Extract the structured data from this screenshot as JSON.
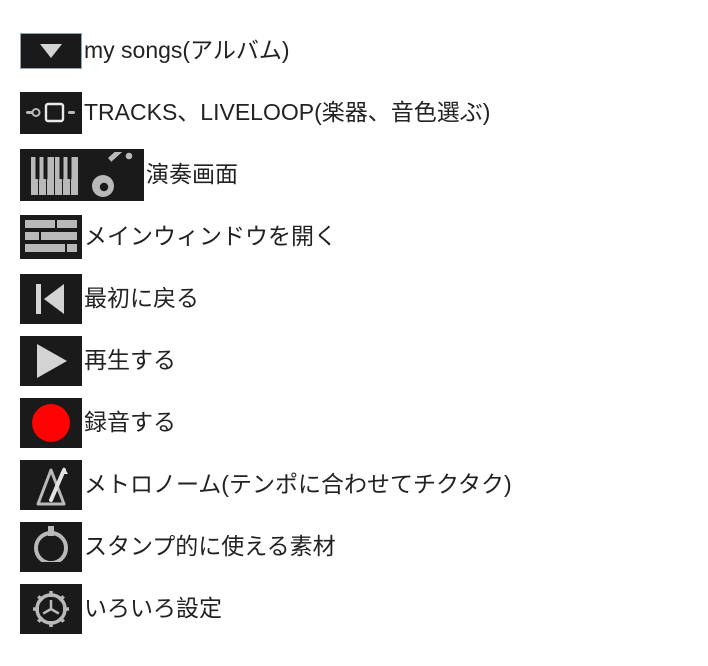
{
  "items": [
    {
      "key": "mysongs",
      "label": "my songs(アルバム)",
      "icon": "down-triangle"
    },
    {
      "key": "tracks",
      "label": "TRACKS、LIVELOOP(楽器、音色選ぶ)",
      "icon": "tracks"
    },
    {
      "key": "perform",
      "label": "演奏画面",
      "icon": "piano-guitar"
    },
    {
      "key": "mainwin",
      "label": "メインウィンドウを開く",
      "icon": "segments"
    },
    {
      "key": "rewind",
      "label": "最初に戻る",
      "icon": "skip-start"
    },
    {
      "key": "play",
      "label": "再生する",
      "icon": "play"
    },
    {
      "key": "record",
      "label": "録音する",
      "icon": "record"
    },
    {
      "key": "metronome",
      "label": "メトロノーム(テンポに合わせてチクタク)",
      "icon": "metronome"
    },
    {
      "key": "loop",
      "label": "スタンプ的に使える素材",
      "icon": "loop-ring"
    },
    {
      "key": "settings",
      "label": "いろいろ設定",
      "icon": "gear"
    }
  ]
}
